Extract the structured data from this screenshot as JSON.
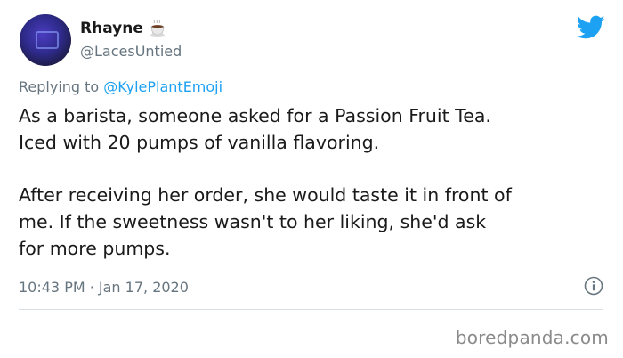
{
  "author": {
    "display_name": "Rhayne",
    "handle": "@LacesUntied",
    "avatar_icon": "avatar-photo",
    "name_emoji": "coffee-icon"
  },
  "reply": {
    "prefix": "Replying to",
    "mention": "@KylePlantEmoji"
  },
  "tweet": {
    "paragraph_1": "As a barista, someone asked for a Passion Fruit Tea.\nIced with 20 pumps of vanilla flavoring.",
    "paragraph_2": "After receiving her order, she would taste it in front of\nme. If the sweetness wasn't to her liking, she'd ask\nfor more pumps.",
    "timestamp": "10:43 PM · Jan 17, 2020"
  },
  "icons": {
    "brand": "twitter-bird-icon",
    "info": "info-icon"
  },
  "colors": {
    "twitter_blue": "#1da1f2",
    "secondary_text": "#66757f",
    "primary_text": "#1a1a1a",
    "divider": "#d8e0e6"
  },
  "watermark": "boredpanda.com"
}
